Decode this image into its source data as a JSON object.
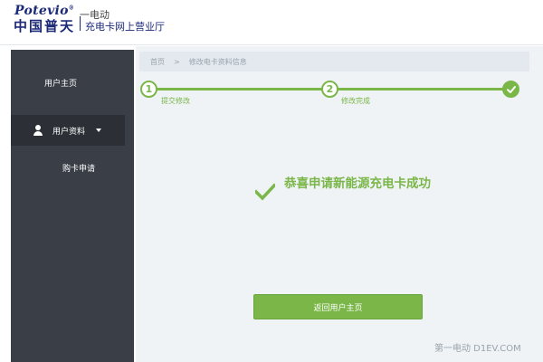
{
  "header": {
    "logo_en": "Potevio",
    "logo_cn": "中国普天",
    "portal_name": "充电卡网上营业厅",
    "overlay_text": "一电动"
  },
  "sidebar": {
    "items": [
      {
        "label": "用户主页"
      },
      {
        "label": "用户资料"
      },
      {
        "label": "购卡申请"
      }
    ]
  },
  "breadcrumb": {
    "home": "首页",
    "separator": ">",
    "current": "修改电卡资料信息"
  },
  "steps": [
    {
      "number": "1",
      "label": "提交修改",
      "status": "done"
    },
    {
      "number": "2",
      "label": "修改完成",
      "status": "done"
    },
    {
      "number": "",
      "label": "",
      "status": "done"
    }
  ],
  "result": {
    "message": "恭喜申请新能源充电卡成功"
  },
  "actions": {
    "return_label": "返回用户主页"
  },
  "watermark": "第一电动 D1EV.COM",
  "colors": {
    "accent": "#7ab648",
    "sidebar_bg": "#3a3f47",
    "brand": "#1d2a78"
  }
}
